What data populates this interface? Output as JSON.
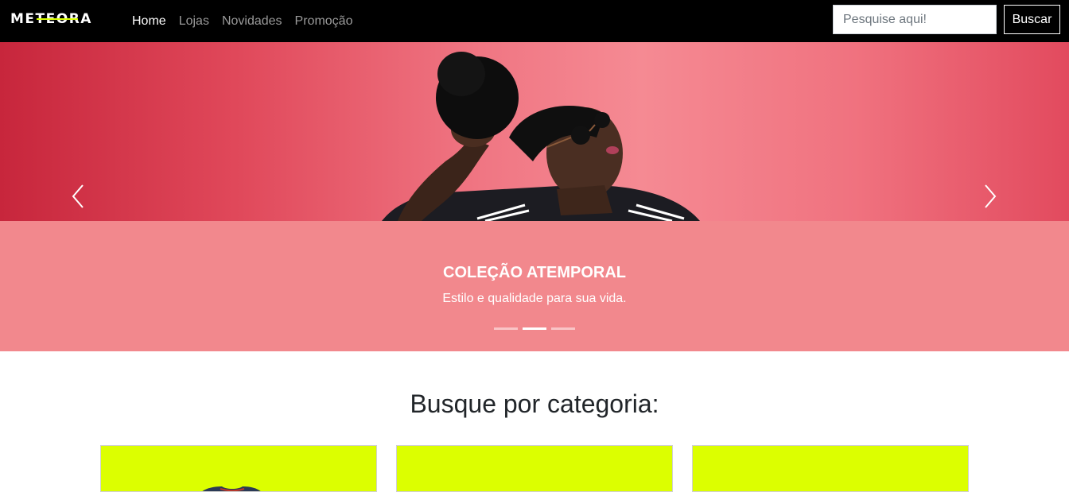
{
  "navbar": {
    "brand": "METEORA",
    "links": [
      {
        "label": "Home",
        "active": true
      },
      {
        "label": "Lojas",
        "active": false
      },
      {
        "label": "Novidades",
        "active": false
      },
      {
        "label": "Promoção",
        "active": false
      }
    ],
    "search": {
      "placeholder": "Pesquise aqui!",
      "value": "",
      "button_label": "Buscar"
    }
  },
  "carousel": {
    "caption_title": "COLEÇÃO ATEMPORAL",
    "caption_subtitle": "Estilo e qualidade para sua vida.",
    "slide_count": 3,
    "active_slide": 2,
    "prev_icon": "chevron-left-icon",
    "next_icon": "chevron-right-icon"
  },
  "categories": {
    "title": "Busque por categoria:",
    "cards": [
      {
        "image": "category-image-tshirt"
      },
      {
        "image": "category-image"
      },
      {
        "image": "category-image"
      }
    ]
  },
  "colors": {
    "navbar_bg": "#000000",
    "accent": "#dcff00",
    "caption_bg": "#f2888d"
  }
}
